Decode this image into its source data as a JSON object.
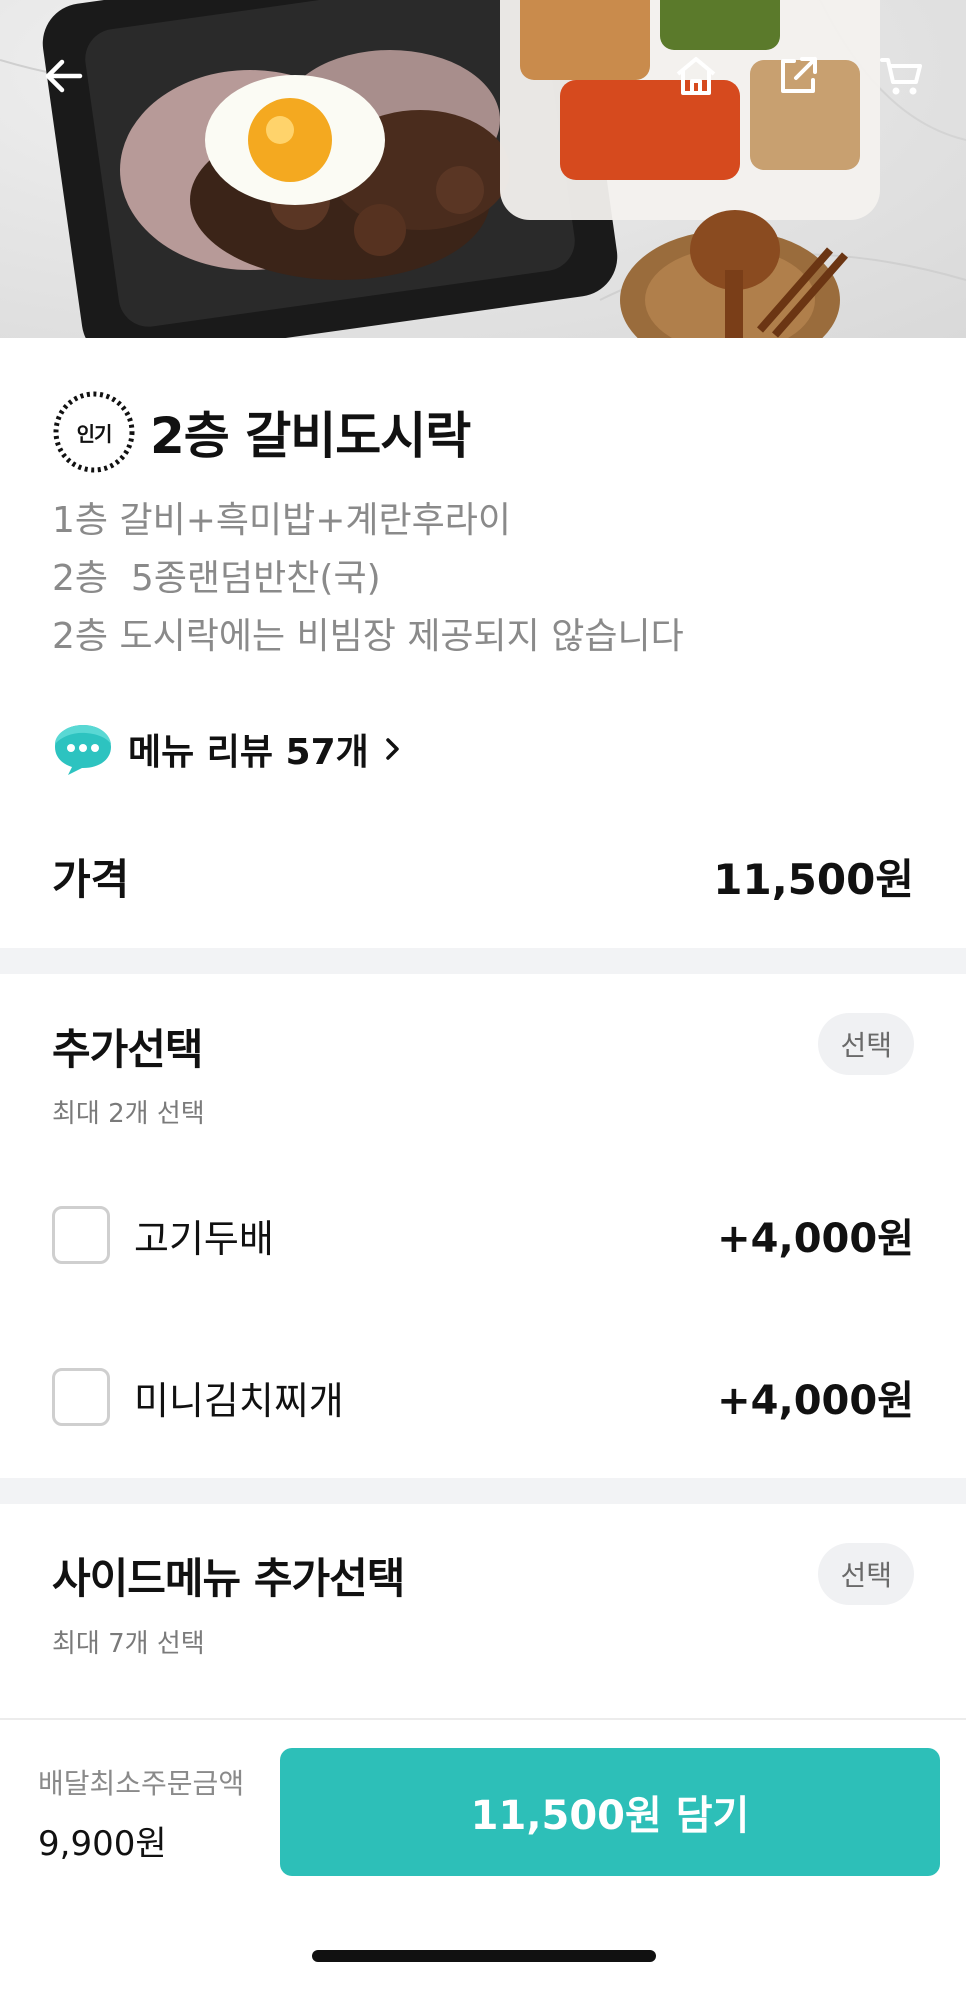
{
  "header": {
    "back_icon": "arrow-left-icon",
    "home_icon": "home-icon",
    "share_icon": "share-icon",
    "cart_icon": "cart-icon"
  },
  "menu": {
    "badge": "인기",
    "title": "2층 갈비도시락",
    "description": [
      "1층 갈비+흑미밥+계란후라이",
      "2층  5종랜덤반찬(국)",
      "2층 도시락에는 비빔장 제공되지 않습니다"
    ],
    "review_label": "메뉴 리뷰 57개",
    "price_label": "가격",
    "price_value": "11,500원"
  },
  "option_group_1": {
    "title": "추가선택",
    "subtitle": "최대 2개 선택",
    "pill": "선택",
    "options": [
      {
        "name": "고기두배",
        "price": "+4,000원",
        "checked": false
      },
      {
        "name": "미니김치찌개",
        "price": "+4,000원",
        "checked": false
      }
    ]
  },
  "option_group_2": {
    "title": "사이드메뉴 추가선택",
    "subtitle": "최대 7개 선택",
    "pill": "선택"
  },
  "footer": {
    "min_order_label": "배달최소주문금액",
    "min_order_value": "9,900원",
    "cta_label": "11,500원 담기"
  },
  "colors": {
    "accent": "#2dbfb8",
    "divider": "#f2f3f5",
    "muted_text": "#8a8a8a"
  }
}
